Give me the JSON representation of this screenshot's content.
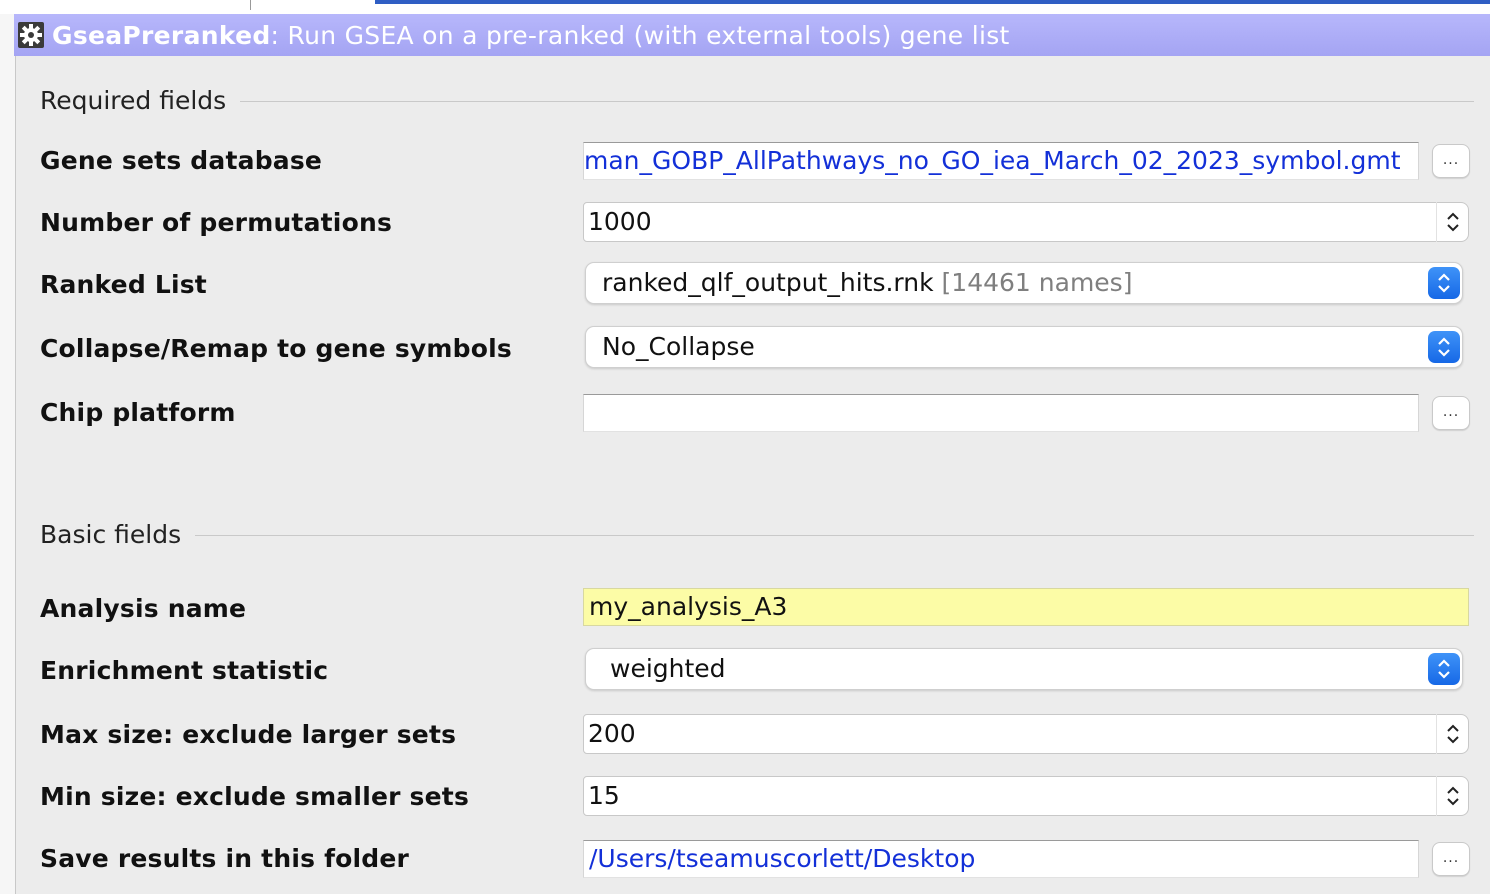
{
  "window": {
    "title_name": "GseaPreranked",
    "title_desc": ": Run GSEA on a pre-ranked (with external tools) gene list"
  },
  "required": {
    "section_label": "Required fields",
    "gene_sets_label": "Gene sets database",
    "gene_sets_value": "man_GOBP_AllPathways_no_GO_iea_March_02_2023_symbol.gmt",
    "permutations_label": "Number of permutations",
    "permutations_value": "1000",
    "ranked_list_label": "Ranked List",
    "ranked_list_value": "ranked_qlf_output_hits.rnk",
    "ranked_list_note": "[14461 names]",
    "collapse_label": "Collapse/Remap to gene symbols",
    "collapse_value": "No_Collapse",
    "chip_label": "Chip platform",
    "chip_value": ""
  },
  "basic": {
    "section_label": "Basic fields",
    "analysis_name_label": "Analysis name",
    "analysis_name_value": "my_analysis_A3",
    "enrichment_label": "Enrichment statistic",
    "enrichment_value": "weighted",
    "max_size_label": "Max size: exclude larger sets",
    "max_size_value": "200",
    "min_size_label": "Min size: exclude smaller sets",
    "min_size_value": "15",
    "save_folder_label": "Save results in this folder",
    "save_folder_value": "/Users/tseamuscorlett/Desktop"
  },
  "buttons": {
    "browse_label": "..."
  },
  "colors": {
    "title_bar": "#a4a4f3",
    "link_text": "#1330d8",
    "highlight_field": "#fcfca6",
    "combo_button": "#1668e6"
  },
  "icons": {
    "title": "gear-icon",
    "spinner": "spinner-arrows-icon",
    "combo": "updown-chevron-icon"
  }
}
